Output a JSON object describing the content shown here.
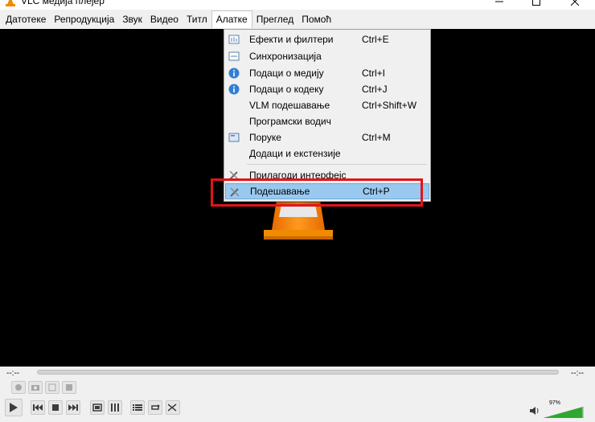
{
  "window": {
    "title": "VLC медија плејер",
    "app_icon": "vlc-cone-icon"
  },
  "menubar": [
    {
      "label": "Датотеке"
    },
    {
      "label": "Репродукција"
    },
    {
      "label": "Звук"
    },
    {
      "label": "Видео"
    },
    {
      "label": "Титл"
    },
    {
      "label": "Алатке",
      "active": true
    },
    {
      "label": "Преглед"
    },
    {
      "label": "Помоћ"
    }
  ],
  "tools_menu": {
    "items": [
      {
        "label": "Ефекти и филтери",
        "shortcut": "Ctrl+E",
        "icon": "equalizer-icon"
      },
      {
        "label": "Синхронизација",
        "shortcut": "",
        "icon": "sync-icon"
      },
      {
        "label": "Подаци о медију",
        "shortcut": "Ctrl+I",
        "icon": "info-icon"
      },
      {
        "label": "Подаци о кодеку",
        "shortcut": "Ctrl+J",
        "icon": "info-icon"
      },
      {
        "label": "VLM подешавање",
        "shortcut": "Ctrl+Shift+W",
        "icon": ""
      },
      {
        "label": "Програмски водич",
        "shortcut": "",
        "icon": ""
      },
      {
        "label": "Поруке",
        "shortcut": "Ctrl+M",
        "icon": "messages-icon"
      },
      {
        "label": "Додаци и екстензије",
        "shortcut": "",
        "icon": ""
      },
      {
        "label": "Прилагоди интерфејс",
        "shortcut": "",
        "icon": "tools-icon"
      },
      {
        "label": "Подешавање",
        "shortcut": "Ctrl+P",
        "icon": "tools-icon",
        "selected": true
      }
    ]
  },
  "controls": {
    "time_elapsed": "--:--",
    "time_total": "--:--",
    "volume_percent": "97%",
    "volume_level": 0.97
  },
  "colors": {
    "highlight": "#e2141c",
    "selection": "#99c9ef",
    "volume": "#2ea82e"
  }
}
